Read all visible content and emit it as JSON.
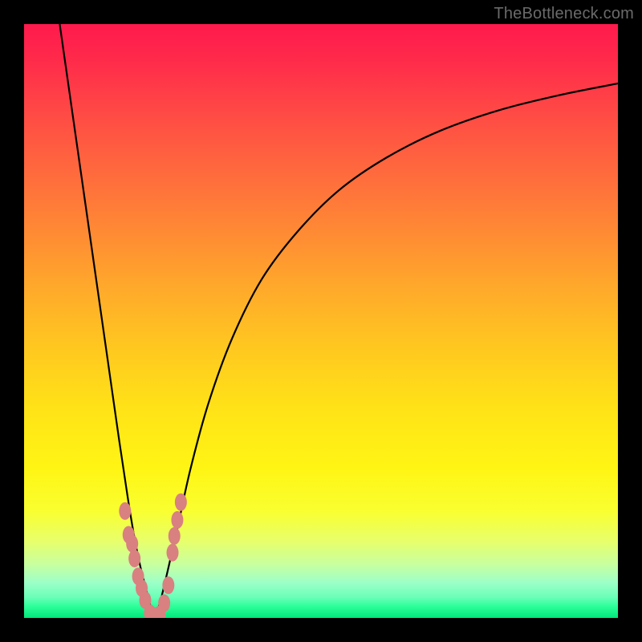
{
  "watermark": "TheBottleneck.com",
  "chart_data": {
    "type": "line",
    "title": "",
    "xlabel": "",
    "ylabel": "",
    "xlim": [
      0,
      100
    ],
    "ylim": [
      0,
      100
    ],
    "grid": false,
    "legend": false,
    "series": [
      {
        "name": "left-branch",
        "x": [
          6,
          8,
          10,
          12,
          14,
          16,
          17.5,
          18.5,
          19.5,
          20.5,
          21.3,
          22
        ],
        "y": [
          100,
          86,
          72,
          58,
          44,
          30,
          20,
          14,
          9,
          5,
          2,
          0
        ]
      },
      {
        "name": "right-branch",
        "x": [
          22,
          23,
          24.2,
          25.8,
          28,
          31,
          35,
          40,
          46,
          53,
          61,
          70,
          80,
          90,
          100
        ],
        "y": [
          0,
          3,
          8,
          15,
          25,
          36,
          47,
          57,
          65,
          72,
          77.5,
          82,
          85.5,
          88,
          90
        ]
      }
    ],
    "markers": [
      {
        "x": 17.0,
        "y": 18.0
      },
      {
        "x": 17.6,
        "y": 14.0
      },
      {
        "x": 18.2,
        "y": 12.5
      },
      {
        "x": 18.6,
        "y": 10.0
      },
      {
        "x": 19.2,
        "y": 7.0
      },
      {
        "x": 19.8,
        "y": 5.0
      },
      {
        "x": 20.4,
        "y": 3.0
      },
      {
        "x": 21.2,
        "y": 0.8
      },
      {
        "x": 22.0,
        "y": 0.3
      },
      {
        "x": 22.8,
        "y": 0.6
      },
      {
        "x": 23.6,
        "y": 2.5
      },
      {
        "x": 24.3,
        "y": 5.5
      },
      {
        "x": 25.0,
        "y": 11.0
      },
      {
        "x": 25.3,
        "y": 13.8
      },
      {
        "x": 25.8,
        "y": 16.5
      },
      {
        "x": 26.4,
        "y": 19.5
      }
    ],
    "gradient_stops": [
      {
        "pos": 0,
        "color": "#ff1a4d"
      },
      {
        "pos": 50,
        "color": "#ffc91f"
      },
      {
        "pos": 82,
        "color": "#f9ff30"
      },
      {
        "pos": 100,
        "color": "#00e87a"
      }
    ]
  }
}
